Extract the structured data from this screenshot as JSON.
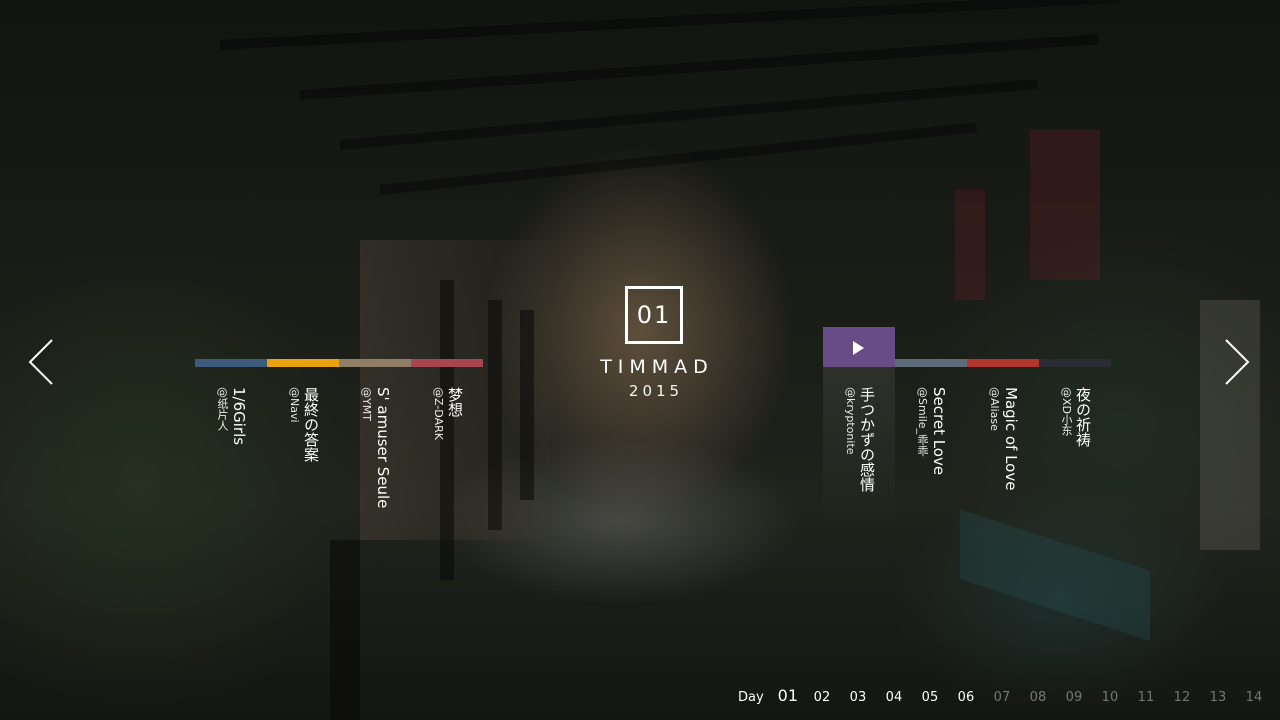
{
  "logo": {
    "number": "01",
    "title": "TIMMAD",
    "year": "2015"
  },
  "nav": {
    "prev_icon": "chevron-left-icon",
    "next_icon": "chevron-right-icon"
  },
  "tracks_left": [
    {
      "title": "1/6Girls",
      "artist": "@纸片人",
      "color": "#3f5b7b"
    },
    {
      "title": "最終の答案",
      "artist": "@Navi",
      "color": "#e8a10f"
    },
    {
      "title": "S' amuser Seule",
      "artist": "@YMT",
      "color": "#8e7f66"
    },
    {
      "title": "梦想",
      "artist": "@Z-DARK",
      "color": "#a54650"
    }
  ],
  "tracks_right": [
    {
      "title": "手つかずの感情",
      "artist": "@kryptonite",
      "color": "#674c86",
      "active": true
    },
    {
      "title": "Secret Love",
      "artist": "@Smile_乖乖",
      "color": "#5e6b78"
    },
    {
      "title": "Magic of Love",
      "artist": "@Aliase",
      "color": "#b1372e"
    },
    {
      "title": "夜の祈祷",
      "artist": "@XD小东",
      "color": "#2b2c34"
    }
  ],
  "days": {
    "label": "Day",
    "items": [
      "01",
      "02",
      "03",
      "04",
      "05",
      "06",
      "07",
      "08",
      "09",
      "10",
      "11",
      "12",
      "13",
      "14"
    ],
    "current": "01",
    "available_count": 6
  }
}
